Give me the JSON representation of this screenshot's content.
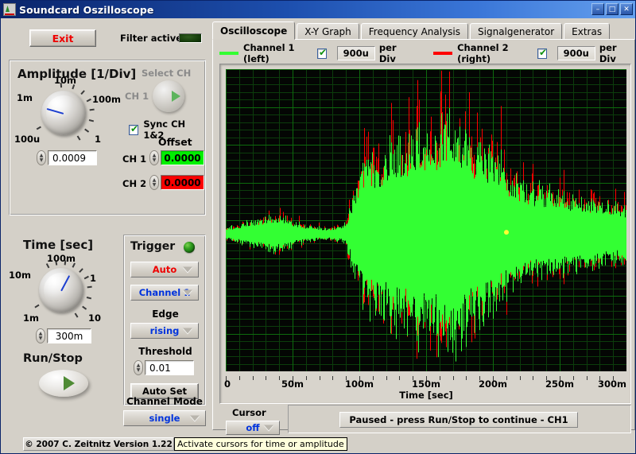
{
  "window": {
    "title": "Soundcard Oszilloscope",
    "icon": "oscilloscope-icon",
    "minimize_label": "–",
    "maximize_label": "□",
    "close_label": "✕"
  },
  "left": {
    "exit_label": "Exit",
    "filter_label": "Filter active",
    "amplitude": {
      "title": "Amplitude [1/Div]",
      "knob_labels": [
        "100u",
        "1m",
        "10m",
        "100m",
        "1"
      ],
      "value": "0.0009"
    },
    "select_ch": {
      "title": "Select CH",
      "channel_label": "CH 1",
      "sync_label": "Sync CH 1&2",
      "sync_checked": true
    },
    "offset": {
      "title": "Offset",
      "ch1_label": "CH 1",
      "ch1_value": "0.0000",
      "ch2_label": "CH 2",
      "ch2_value": "0.0000"
    },
    "time": {
      "title": "Time [sec]",
      "knob_labels": [
        "1m",
        "10m",
        "100m",
        "1",
        "10"
      ],
      "value": "300m"
    },
    "trigger": {
      "title": "Trigger",
      "mode": "Auto",
      "source": "Channel 1",
      "edge_label": "Edge",
      "edge": "rising",
      "threshold_label": "Threshold",
      "threshold": "0.01",
      "auto_set_label": "Auto Set"
    },
    "run_stop_label": "Run/Stop",
    "channel_mode": {
      "label": "Channel Mode",
      "value": "single"
    },
    "copyright": "© 2007   C. Zeitnitz Version 1.22"
  },
  "tabs": [
    {
      "label": "Oscilloscope",
      "active": true
    },
    {
      "label": "X-Y Graph",
      "active": false
    },
    {
      "label": "Frequency Analysis",
      "active": false
    },
    {
      "label": "Signalgenerator",
      "active": false
    },
    {
      "label": "Extras",
      "active": false
    }
  ],
  "legend": {
    "ch1_label": "Channel 1 (left)",
    "ch1_color": "#33ff33",
    "ch1_checked": true,
    "ch1_perdiv": "900u",
    "ch2_label": "Channel 2 (right)",
    "ch2_color": "#ff0000",
    "ch2_checked": true,
    "ch2_perdiv": "900u",
    "per_div_label": "per Div"
  },
  "cursor": {
    "label": "Cursor",
    "value": "off"
  },
  "status": "Paused - press Run/Stop to continue - CH1",
  "tooltip": "Activate cursors for time or amplitude",
  "chart_data": {
    "type": "line",
    "title": "",
    "xlabel": "Time [sec]",
    "ylabel": "",
    "xlim": [
      0,
      0.3
    ],
    "xticks": [
      0,
      0.05,
      0.1,
      0.15,
      0.2,
      0.25,
      0.3
    ],
    "xticklabels": [
      "0",
      "50m",
      "100m",
      "150m",
      "200m",
      "250m",
      "300m"
    ],
    "grid": true,
    "grid_color": "#0d6b0d",
    "background": "#040604",
    "divisions_x": 6,
    "divisions_y": 8,
    "series": [
      {
        "name": "Channel 1 (left)",
        "color": "#33ff33",
        "volts_per_div": "900u"
      },
      {
        "name": "Channel 2 (right)",
        "color": "#ff0000",
        "volts_per_div": "900u"
      }
    ],
    "waveform_note": "Audio waveform: low-amplitude noise 0-95ms, loud burst 95-210ms, decaying tail to 300ms",
    "envelope_ch1": [
      {
        "t": 0.0,
        "amp": 0.035
      },
      {
        "t": 0.006,
        "amp": 0.055
      },
      {
        "t": 0.012,
        "amp": 0.07
      },
      {
        "t": 0.018,
        "amp": 0.085
      },
      {
        "t": 0.024,
        "amp": 0.1
      },
      {
        "t": 0.03,
        "amp": 0.115
      },
      {
        "t": 0.036,
        "amp": 0.13
      },
      {
        "t": 0.042,
        "amp": 0.12
      },
      {
        "t": 0.048,
        "amp": 0.095
      },
      {
        "t": 0.054,
        "amp": 0.075
      },
      {
        "t": 0.06,
        "amp": 0.06
      },
      {
        "t": 0.066,
        "amp": 0.05
      },
      {
        "t": 0.072,
        "amp": 0.042
      },
      {
        "t": 0.078,
        "amp": 0.038
      },
      {
        "t": 0.084,
        "amp": 0.05
      },
      {
        "t": 0.09,
        "amp": 0.075
      },
      {
        "t": 0.096,
        "amp": 0.3
      },
      {
        "t": 0.102,
        "amp": 0.48
      },
      {
        "t": 0.108,
        "amp": 0.56
      },
      {
        "t": 0.114,
        "amp": 0.52
      },
      {
        "t": 0.12,
        "amp": 0.6
      },
      {
        "t": 0.126,
        "amp": 0.66
      },
      {
        "t": 0.132,
        "amp": 0.62
      },
      {
        "t": 0.138,
        "amp": 0.7
      },
      {
        "t": 0.144,
        "amp": 0.76
      },
      {
        "t": 0.15,
        "amp": 0.72
      },
      {
        "t": 0.156,
        "amp": 0.68
      },
      {
        "t": 0.162,
        "amp": 0.74
      },
      {
        "t": 0.168,
        "amp": 0.8
      },
      {
        "t": 0.174,
        "amp": 0.76
      },
      {
        "t": 0.18,
        "amp": 0.7
      },
      {
        "t": 0.186,
        "amp": 0.64
      },
      {
        "t": 0.192,
        "amp": 0.6
      },
      {
        "t": 0.198,
        "amp": 0.56
      },
      {
        "t": 0.204,
        "amp": 0.5
      },
      {
        "t": 0.21,
        "amp": 0.44
      },
      {
        "t": 0.216,
        "amp": 0.4
      },
      {
        "t": 0.222,
        "amp": 0.36
      },
      {
        "t": 0.228,
        "amp": 0.33
      },
      {
        "t": 0.234,
        "amp": 0.31
      },
      {
        "t": 0.24,
        "amp": 0.3
      },
      {
        "t": 0.246,
        "amp": 0.29
      },
      {
        "t": 0.252,
        "amp": 0.28
      },
      {
        "t": 0.258,
        "amp": 0.27
      },
      {
        "t": 0.264,
        "amp": 0.26
      },
      {
        "t": 0.27,
        "amp": 0.25
      },
      {
        "t": 0.276,
        "amp": 0.235
      },
      {
        "t": 0.282,
        "amp": 0.22
      },
      {
        "t": 0.288,
        "amp": 0.205
      },
      {
        "t": 0.294,
        "amp": 0.195
      },
      {
        "t": 0.3,
        "amp": 0.185
      }
    ],
    "baseline_y_frac": 0.545
  }
}
